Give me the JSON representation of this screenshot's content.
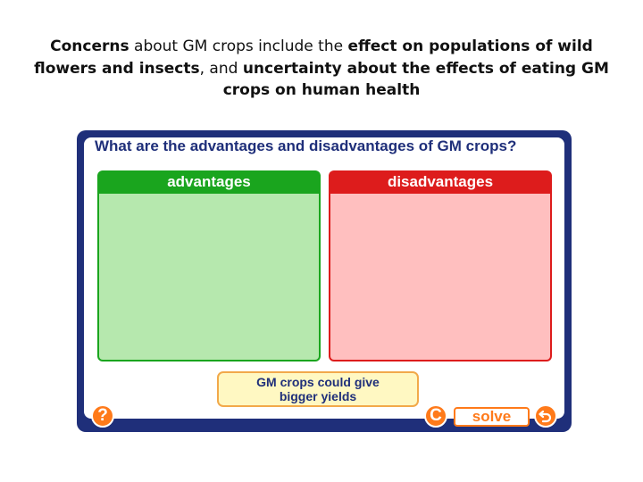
{
  "caption": {
    "bold1": "Concerns",
    "normal1": " about GM crops include the ",
    "bold2": "effect on populations of wild flowers and insects",
    "normal2": ", and ",
    "bold3": "uncertainty about the effects of eating GM crops on human health"
  },
  "activity": {
    "question": "What are the advantages and disadvantages of GM crops?",
    "columns": {
      "advantages": {
        "label": "advantages",
        "color": "#1aa51e"
      },
      "disadvantages": {
        "label": "disadvantages",
        "color": "#dd1c1c"
      }
    },
    "card": {
      "line1": "GM crops could give",
      "line2": "bigger yields"
    },
    "controls": {
      "help_label": "?",
      "reset_label": "C",
      "solve_label": "solve"
    },
    "icons": {
      "help": "question-icon",
      "reset": "reset-icon",
      "undo": "undo-arrow-icon"
    },
    "accent": "#ff7a1a",
    "frame_color": "#1f2f7a"
  }
}
